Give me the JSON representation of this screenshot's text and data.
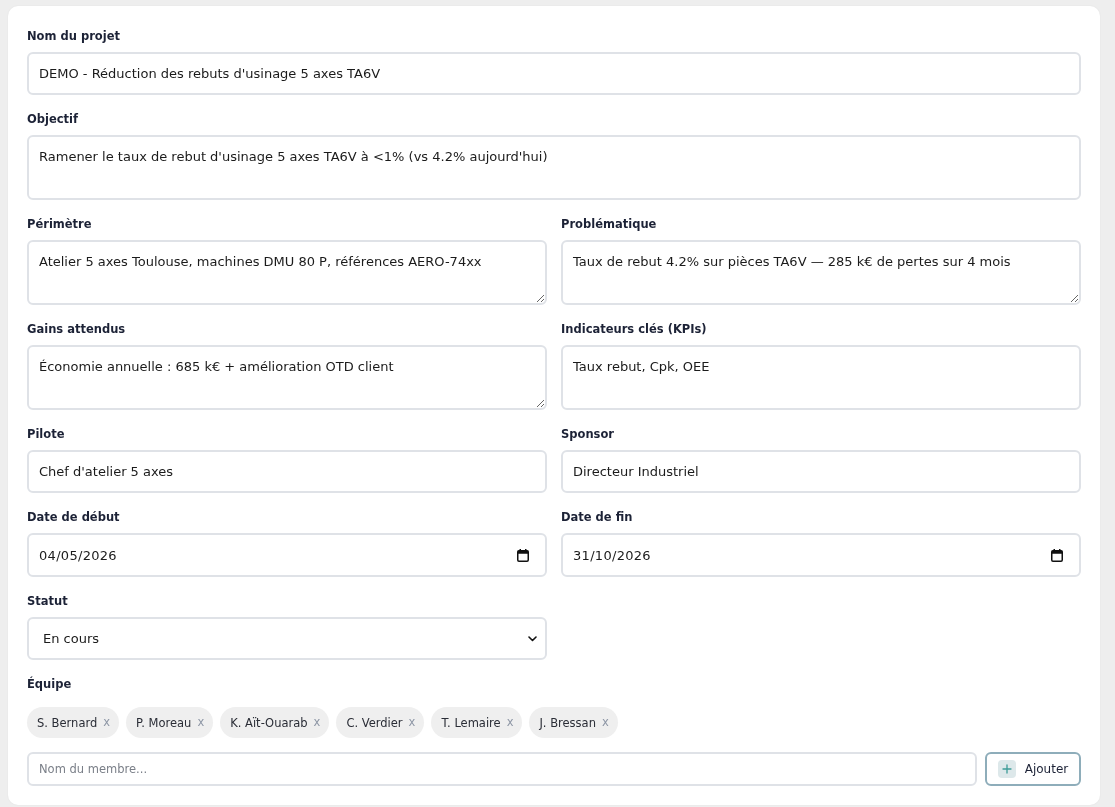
{
  "main_fields": [
    {
      "label": "Nom du projet",
      "kind": "text",
      "value": "DEMO - Réduction des rebuts d'usinage 5 axes TA6V"
    },
    {
      "label": "Objectif",
      "kind": "textarea",
      "value": "Ramener le taux de rebut d'usinage 5 axes TA6V à <1% (vs 4.2% aujourd'hui)",
      "resizable": false
    }
  ],
  "detail_fields": [
    {
      "label": "Périmètre",
      "kind": "textarea",
      "value": "Atelier 5 axes Toulouse, machines DMU 80 P, références AERO-74xx",
      "resizable": true
    },
    {
      "label": "Problématique",
      "kind": "textarea",
      "value": "Taux de rebut 4.2% sur pièces TA6V — 285 k€ de pertes sur 4 mois",
      "resizable": true
    },
    {
      "label": "Gains attendus",
      "kind": "textarea",
      "value": "Économie annuelle : 685 k€ + amélioration OTD client",
      "resizable": true
    },
    {
      "label": "Indicateurs clés (KPIs)",
      "kind": "textarea",
      "value": "Taux rebut, Cpk, OEE",
      "resizable": false
    },
    {
      "label": "Pilote",
      "kind": "text",
      "value": "Chef d'atelier 5 axes"
    },
    {
      "label": "Sponsor",
      "kind": "text",
      "value": "Directeur Industriel"
    },
    {
      "label": "Date de début",
      "kind": "date",
      "value": "04/05/2026"
    },
    {
      "label": "Date de fin",
      "kind": "date",
      "value": "31/10/2026"
    },
    {
      "label": "Statut",
      "kind": "select",
      "value": "En cours"
    }
  ],
  "team": {
    "label": "Équipe",
    "members": [
      {
        "name": "S. Bernard",
        "remove": "x"
      },
      {
        "name": "P. Moreau",
        "remove": "x"
      },
      {
        "name": "K. Aït-Ouarab",
        "remove": "x"
      },
      {
        "name": "C. Verdier",
        "remove": "x"
      },
      {
        "name": "T. Lemaire",
        "remove": "x"
      },
      {
        "name": "J. Bressan",
        "remove": "x"
      }
    ],
    "new_member": {
      "placeholder": "Nom du membre..."
    },
    "add_button": {
      "label": "Ajouter"
    }
  }
}
